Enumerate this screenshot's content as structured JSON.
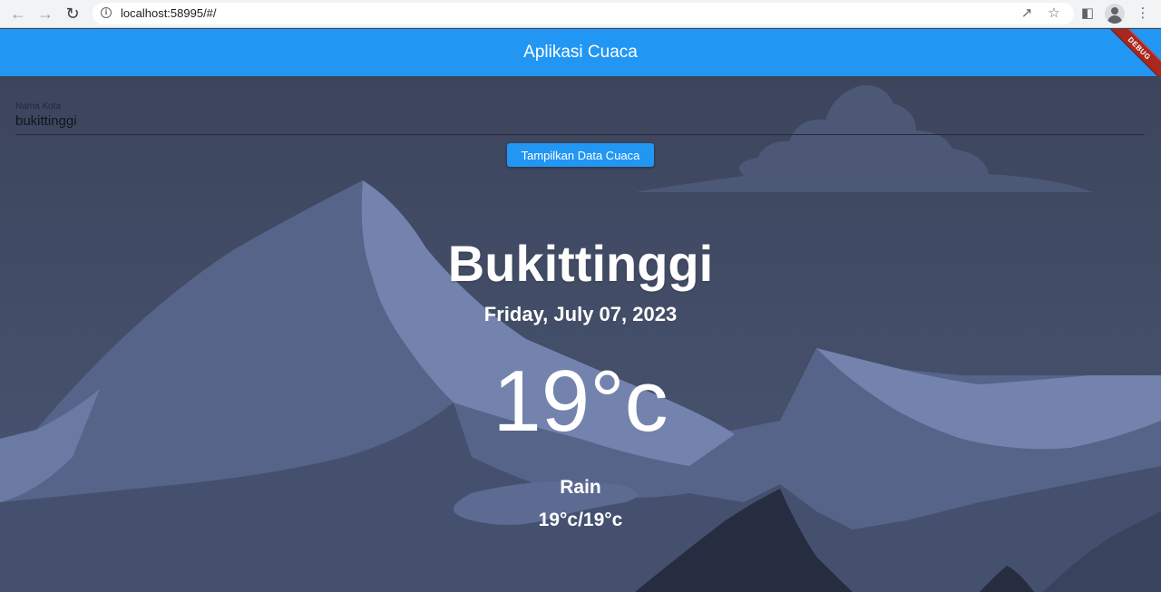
{
  "browser": {
    "url": "localhost:58995/#/",
    "back_icon": "back-arrow-icon",
    "forward_icon": "forward-arrow-icon",
    "reload_icon": "reload-icon"
  },
  "app": {
    "title": "Aplikasi Cuaca",
    "debug_banner": "DEBUG",
    "accent_color": "#2196f3"
  },
  "form": {
    "label": "Nama Kota",
    "value": "bukittinggi",
    "button_label": "Tampilkan Data Cuaca"
  },
  "weather": {
    "city": "Bukittinggi",
    "date": "Friday, July 07, 2023",
    "temperature": "19°c",
    "condition": "Rain",
    "min_max": "19°c/19°c"
  }
}
